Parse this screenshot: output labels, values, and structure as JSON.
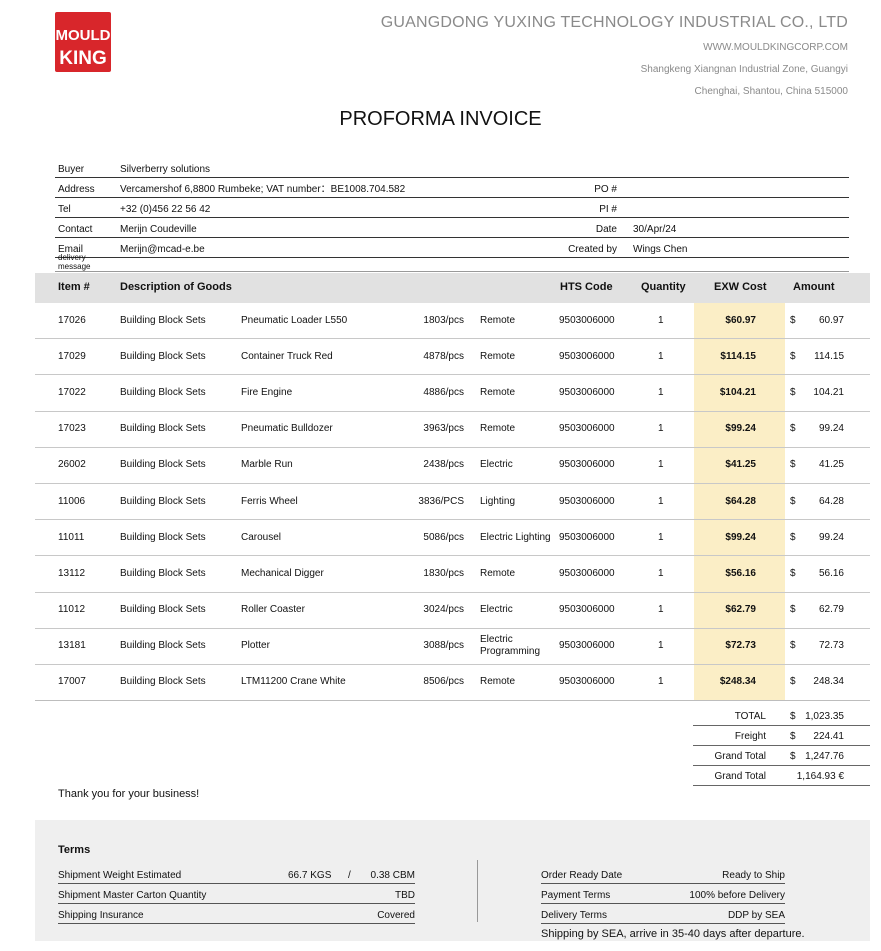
{
  "logo": {
    "top": "MOULD",
    "bottom": "KING"
  },
  "company": {
    "name": "GUANGDONG YUXING TECHNOLOGY INDUSTRIAL CO., LTD",
    "website": "WWW.MOULDKINGCORP.COM",
    "address1": "Shangkeng Xiangnan Industrial Zone, Guangyi",
    "address2": "Chenghai, Shantou, China 515000"
  },
  "doc_title": "PROFORMA INVOICE",
  "info": {
    "buyer_label": "Buyer",
    "buyer": "Silverberry solutions",
    "address_label": "Address",
    "address": "Vercamershof 6,8800 Rumbeke;  VAT number：BE1008.704.582",
    "po_label": "PO #",
    "po": "",
    "tel_label": "Tel",
    "tel": "+32 (0)456 22 56 42",
    "pi_label": "PI #",
    "pi": "",
    "contact_label": "Contact",
    "contact": "Merijn Coudeville",
    "date_label": "Date",
    "date": "30/Apr/24",
    "email_label": "Email",
    "email": "Merijn@mcad-e.be",
    "created_label": "Created by",
    "created": "Wings Chen",
    "delivery_label": "delivery message",
    "delivery": ""
  },
  "table": {
    "headers": {
      "item": "Item #",
      "desc": "Description of Goods",
      "hts": "HTS Code",
      "qty": "Quantity",
      "exw": "EXW Cost",
      "amount": "Amount"
    },
    "currency": "$",
    "rows": [
      {
        "item": "17026",
        "category": "Building Block Sets",
        "name": "Pneumatic Loader L550",
        "pcs": "1803/pcs",
        "type": "Remote",
        "hts": "9503006000",
        "qty": "1",
        "exw": "$60.97",
        "amount": "60.97"
      },
      {
        "item": "17029",
        "category": "Building Block Sets",
        "name": "Container Truck Red",
        "pcs": "4878/pcs",
        "type": "Remote",
        "hts": "9503006000",
        "qty": "1",
        "exw": "$114.15",
        "amount": "114.15"
      },
      {
        "item": "17022",
        "category": "Building Block Sets",
        "name": "Fire Engine",
        "pcs": "4886/pcs",
        "type": "Remote",
        "hts": "9503006000",
        "qty": "1",
        "exw": "$104.21",
        "amount": "104.21"
      },
      {
        "item": "17023",
        "category": "Building Block Sets",
        "name": "Pneumatic Bulldozer",
        "pcs": "3963/pcs",
        "type": "Remote",
        "hts": "9503006000",
        "qty": "1",
        "exw": "$99.24",
        "amount": "99.24"
      },
      {
        "item": "26002",
        "category": "Building Block Sets",
        "name": "Marble Run",
        "pcs": "2438/pcs",
        "type": "Electric",
        "hts": "9503006000",
        "qty": "1",
        "exw": "$41.25",
        "amount": "41.25"
      },
      {
        "item": "11006",
        "category": "Building Block Sets",
        "name": "Ferris Wheel",
        "pcs": "3836/PCS",
        "type": "Lighting",
        "hts": "9503006000",
        "qty": "1",
        "exw": "$64.28",
        "amount": "64.28"
      },
      {
        "item": "11011",
        "category": "Building Block Sets",
        "name": "Carousel",
        "pcs": "5086/pcs",
        "type": "Electric Lighting",
        "hts": "9503006000",
        "qty": "1",
        "exw": "$99.24",
        "amount": "99.24"
      },
      {
        "item": "13112",
        "category": "Building Block Sets",
        "name": "Mechanical Digger",
        "pcs": "1830/pcs",
        "type": "Remote",
        "hts": "9503006000",
        "qty": "1",
        "exw": "$56.16",
        "amount": "56.16"
      },
      {
        "item": "11012",
        "category": "Building Block Sets",
        "name": "Roller Coaster",
        "pcs": "3024/pcs",
        "type": "Electric",
        "hts": "9503006000",
        "qty": "1",
        "exw": "$62.79",
        "amount": "62.79"
      },
      {
        "item": "13181",
        "category": "Building Block Sets",
        "name": "Plotter",
        "pcs": "3088/pcs",
        "type": "Electric Programming",
        "hts": "9503006000",
        "qty": "1",
        "exw": "$72.73",
        "amount": "72.73"
      },
      {
        "item": "17007",
        "category": "Building Block Sets",
        "name": "LTM11200 Crane White",
        "pcs": "8506/pcs",
        "type": "Remote",
        "hts": "9503006000",
        "qty": "1",
        "exw": "$248.34",
        "amount": "248.34"
      }
    ]
  },
  "totals": {
    "total_label": "TOTAL",
    "total_cur": "$",
    "total": "1,023.35",
    "freight_label": "Freight",
    "freight_cur": "$",
    "freight": "224.41",
    "grand_label": "Grand Total",
    "grand_cur": "$",
    "grand": "1,247.76",
    "grand_eur_label": "Grand Total",
    "grand_eur": "1,164.93 €"
  },
  "thanks": "Thank you for your business!",
  "terms": {
    "title": "Terms",
    "weight_label": "Shipment Weight Estimated",
    "weight": "66.7 KGS",
    "weight_sep": "/",
    "cbm": "0.38 CBM",
    "carton_label": "Shipment Master Carton Quantity",
    "carton": "TBD",
    "insurance_label": "Shipping Insurance",
    "insurance": "Covered",
    "ready_label": "Order Ready Date",
    "ready": "Ready to Ship",
    "payment_label": "Payment Terms",
    "payment": "100% before Delivery",
    "delivery_label": "Delivery Terms",
    "delivery": "DDP by SEA",
    "shipping_note": "Shipping by SEA, arrive in 35-40 days after departure."
  }
}
